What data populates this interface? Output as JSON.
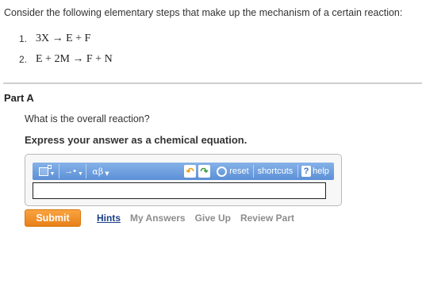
{
  "intro": "Consider the following elementary steps that make up the mechanism of a certain reaction:",
  "steps": [
    {
      "num": "1.",
      "equation": "3X → E + F"
    },
    {
      "num": "2.",
      "equation": "E + 2M → F + N"
    }
  ],
  "part": {
    "title": "Part A"
  },
  "question": "What is the overall reaction?",
  "instruction": "Express your answer as a chemical equation.",
  "toolbar": {
    "template_icon": "template-icon",
    "arrow_label": "→•",
    "greek_label": "αβ",
    "undo_icon": "undo-icon",
    "redo_icon": "redo-icon",
    "reset_label": "reset",
    "shortcuts_label": "shortcuts",
    "help_glyph": "?",
    "help_label": "help"
  },
  "answer": {
    "value": ""
  },
  "actions": {
    "submit": "Submit",
    "hints": "Hints",
    "my_answers": "My Answers",
    "give_up": "Give Up",
    "review_part": "Review Part"
  },
  "colors": {
    "submit": "#f29530",
    "toolbar": "#6f9fe0",
    "hints_link": "#1a3f88",
    "disabled_link": "#8d8d8d"
  }
}
